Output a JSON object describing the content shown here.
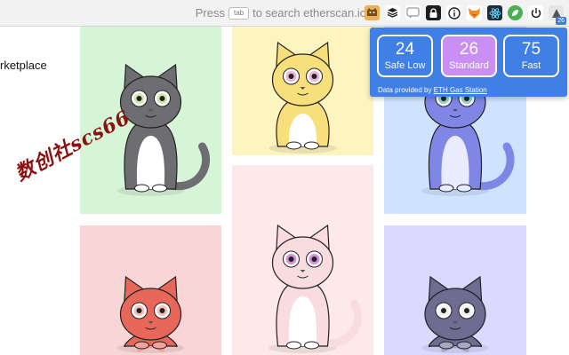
{
  "toolbar": {
    "press_label": "Press",
    "key_label": "tab",
    "search_suffix": "to search etherscan.io",
    "extensions": [
      {
        "icon": "cat-face-icon",
        "color": "#e9b25a"
      },
      {
        "icon": "layers-icon",
        "color": "#222222"
      },
      {
        "icon": "chat-icon",
        "color": "#9a9a9a"
      },
      {
        "icon": "lock-icon",
        "color": "#1d1d1d"
      },
      {
        "icon": "info-icon",
        "color": "#1d1d1d"
      },
      {
        "icon": "fox-icon",
        "color": "#f08a24"
      },
      {
        "icon": "react-atom-icon",
        "color": "#1d2b3a"
      },
      {
        "icon": "green-leaf-icon",
        "color": "#4caf50"
      },
      {
        "icon": "power-icon",
        "color": "#1d1d1d"
      },
      {
        "icon": "gas-pump-icon",
        "color": "#e6e6e6",
        "badge": "26"
      }
    ]
  },
  "page": {
    "heading": "rketplace",
    "watermark": "数创社scs66"
  },
  "cats": [
    {
      "name": "gray-tabby-cat",
      "bg": "#d6f5d6",
      "body": "#6e6e72",
      "belly": "#ffffff",
      "eye": "#cfe8a9",
      "tail": true
    },
    {
      "name": "yellow-cat",
      "bg": "#fdf4bf",
      "body": "#f7df7b",
      "belly": "#ffffff",
      "eye": "#e9b6d6",
      "tail": false
    },
    {
      "name": "blue-spotted-cat",
      "bg": "#cfe3ff",
      "body": "#7f86e6",
      "belly": "#e9ebff",
      "eye": "#9ad0c9",
      "tail": true
    },
    {
      "name": "pink-fluffy-cat",
      "bg": "#fde9ea",
      "body": "#f8dcdf",
      "belly": "#ffffff",
      "eye": "#d393d8",
      "tail": true
    },
    {
      "name": "red-tabby-cat",
      "bg": "#f8d6d6",
      "body": "#e7685b",
      "belly": "#f3a399",
      "eye": "#f5c1b8",
      "tail": false
    },
    {
      "name": "purple-gray-cat",
      "bg": "#dcd8ff",
      "body": "#6f6c92",
      "belly": "#a7a4c4",
      "eye": "#f0f0f0",
      "tail": false
    }
  ],
  "gas": {
    "options": [
      {
        "value": "24",
        "label": "Safe Low"
      },
      {
        "value": "26",
        "label": "Standard"
      },
      {
        "value": "75",
        "label": "Fast"
      }
    ],
    "provided_prefix": "Data provided by",
    "provided_link": "ETH Gas Station",
    "accent": "#3f7fe6",
    "selected_color": "#c98ff5"
  }
}
